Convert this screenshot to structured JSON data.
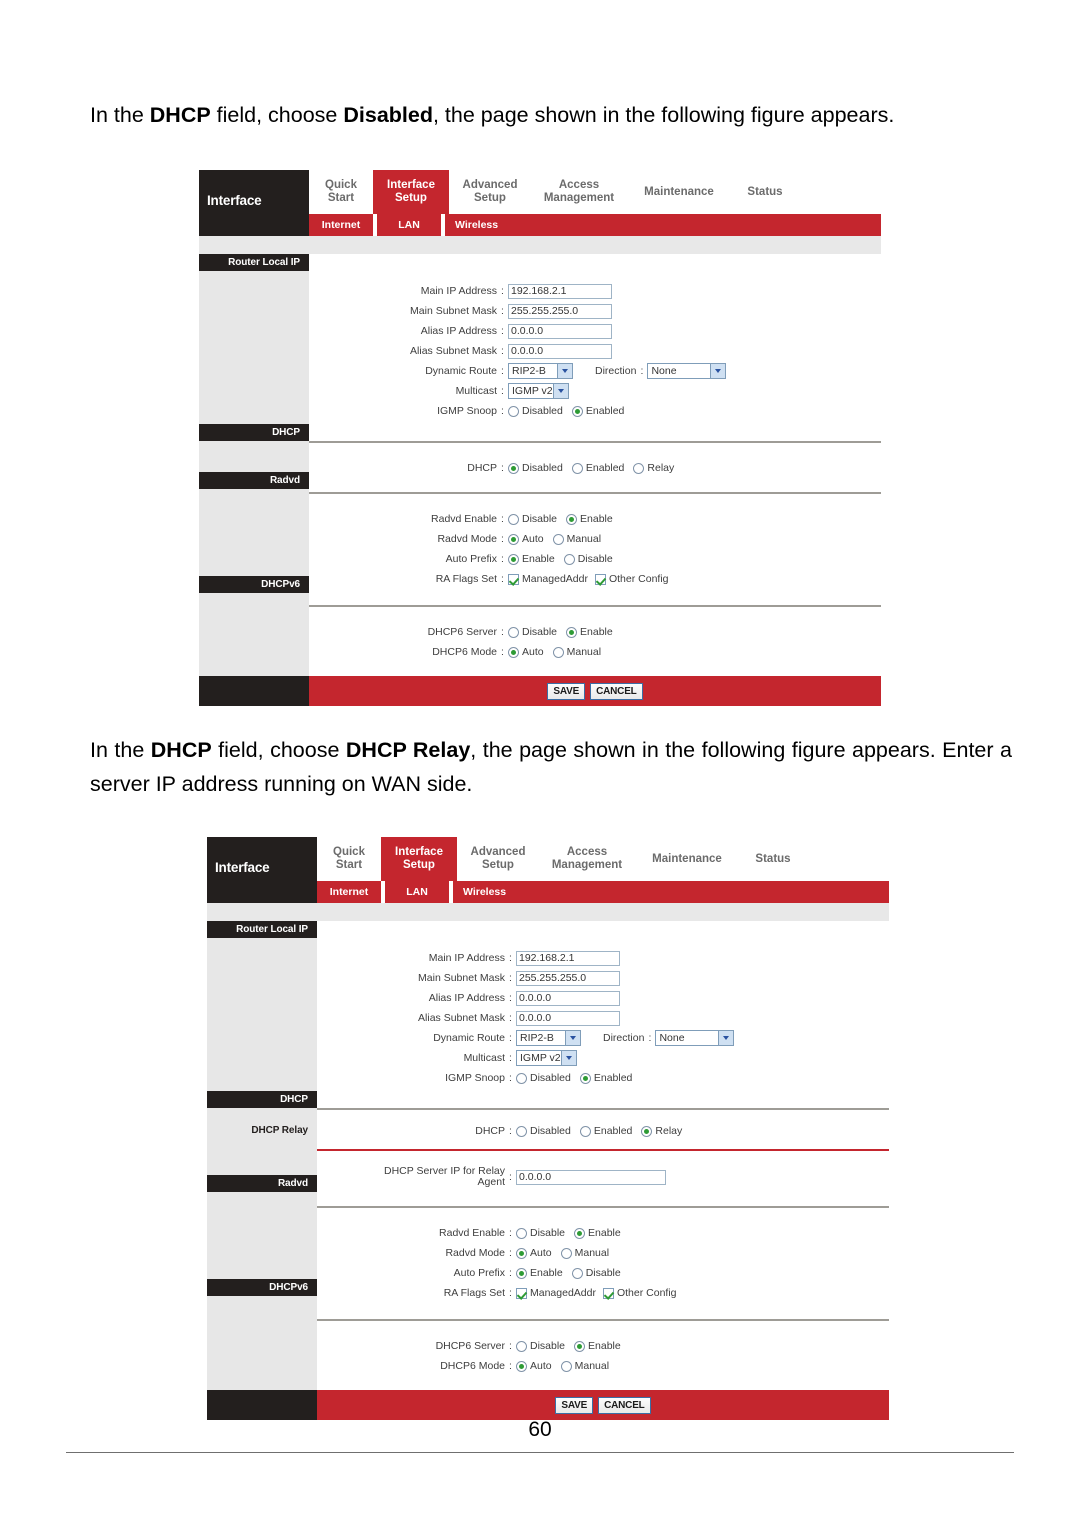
{
  "document": {
    "page_number": "60",
    "paragraph1": {
      "parts": [
        {
          "t": "In the ",
          "b": false
        },
        {
          "t": "DHCP",
          "b": true
        },
        {
          "t": " field, choose ",
          "b": false
        },
        {
          "t": "Disabled",
          "b": true
        },
        {
          "t": ", the page shown in the following figure appears.",
          "b": false
        }
      ]
    },
    "paragraph2": {
      "parts": [
        {
          "t": "In the ",
          "b": false
        },
        {
          "t": "DHCP",
          "b": true
        },
        {
          "t": " field, choose ",
          "b": false
        },
        {
          "t": "DHCP Relay",
          "b": true
        },
        {
          "t": ", the page shown in the following figure appears. Enter a server IP address running on WAN side.",
          "b": false
        }
      ]
    }
  },
  "colors": {
    "brand_red": "#c4262e",
    "dark_panel": "#231f1e",
    "left_column": "#e7e7e7",
    "spacer_gray": "#e8e8e8",
    "rule_gray": "#9e9c96",
    "radio_dot_green": "#2e9b35",
    "input_border": "#9fb4c6"
  },
  "router_ui": {
    "brand": "Interface",
    "tabs": [
      {
        "label": "Quick Start",
        "active": false
      },
      {
        "label": "Interface Setup",
        "active": true
      },
      {
        "label": "Advanced Setup",
        "active": false
      },
      {
        "label": "Access Management",
        "active": false
      },
      {
        "label": "Maintenance",
        "active": false
      },
      {
        "label": "Status",
        "active": false
      }
    ],
    "subtabs": [
      {
        "label": "Internet",
        "active": false
      },
      {
        "label": "LAN",
        "active": true
      },
      {
        "label": "Wireless",
        "active": false
      }
    ],
    "sections": {
      "router_local_ip": {
        "title": "Router Local IP",
        "fields": {
          "main_ip_label": "Main IP Address",
          "main_ip_value": "192.168.2.1",
          "main_subnet_label": "Main Subnet Mask",
          "main_subnet_value": "255.255.255.0",
          "alias_ip_label": "Alias IP Address",
          "alias_ip_value": "0.0.0.0",
          "alias_subnet_label": "Alias Subnet Mask",
          "alias_subnet_value": "0.0.0.0",
          "dynamic_route_label": "Dynamic Route",
          "dynamic_route_value": "RIP2-B",
          "direction_label": "Direction",
          "direction_value": "None",
          "multicast_label": "Multicast",
          "multicast_value": "IGMP v2",
          "igmp_snoop_label": "IGMP Snoop",
          "igmp_snoop_options": [
            {
              "label": "Disabled",
              "selected": false
            },
            {
              "label": "Enabled",
              "selected": true
            }
          ]
        }
      },
      "dhcp_disabled": {
        "title": "DHCP",
        "dhcp_label": "DHCP",
        "dhcp_options": [
          {
            "label": "Disabled",
            "selected": true
          },
          {
            "label": "Enabled",
            "selected": false
          },
          {
            "label": "Relay",
            "selected": false
          }
        ]
      },
      "dhcp_relay_selected": {
        "title": "DHCP",
        "dhcp_label": "DHCP",
        "dhcp_options": [
          {
            "label": "Disabled",
            "selected": false
          },
          {
            "label": "Enabled",
            "selected": false
          },
          {
            "label": "Relay",
            "selected": true
          }
        ],
        "relay_title": "DHCP Relay",
        "relay_field_label_line1": "DHCP Server IP for Relay",
        "relay_field_label_line2": "Agent",
        "relay_field_value": "0.0.0.0"
      },
      "radvd": {
        "title": "Radvd",
        "radvd_enable_label": "Radvd Enable",
        "radvd_enable_options": [
          {
            "label": "Disable",
            "selected": false
          },
          {
            "label": "Enable",
            "selected": true
          }
        ],
        "radvd_mode_label": "Radvd Mode",
        "radvd_mode_options": [
          {
            "label": "Auto",
            "selected": true
          },
          {
            "label": "Manual",
            "selected": false
          }
        ],
        "auto_prefix_label": "Auto Prefix",
        "auto_prefix_options": [
          {
            "label": "Enable",
            "selected": true
          },
          {
            "label": "Disable",
            "selected": false
          }
        ],
        "ra_flags_label": "RA Flags Set",
        "ra_flags_options": [
          {
            "label": "ManagedAddr",
            "checked": true
          },
          {
            "label": "Other Config",
            "checked": true
          }
        ]
      },
      "dhcpv6": {
        "title": "DHCPv6",
        "dhcp6_server_label": "DHCP6 Server",
        "dhcp6_server_options": [
          {
            "label": "Disable",
            "selected": false
          },
          {
            "label": "Enable",
            "selected": true
          }
        ],
        "dhcp6_mode_label": "DHCP6 Mode",
        "dhcp6_mode_options": [
          {
            "label": "Auto",
            "selected": true
          },
          {
            "label": "Manual",
            "selected": false
          }
        ]
      }
    },
    "buttons": {
      "save": "SAVE",
      "cancel": "CANCEL"
    }
  }
}
